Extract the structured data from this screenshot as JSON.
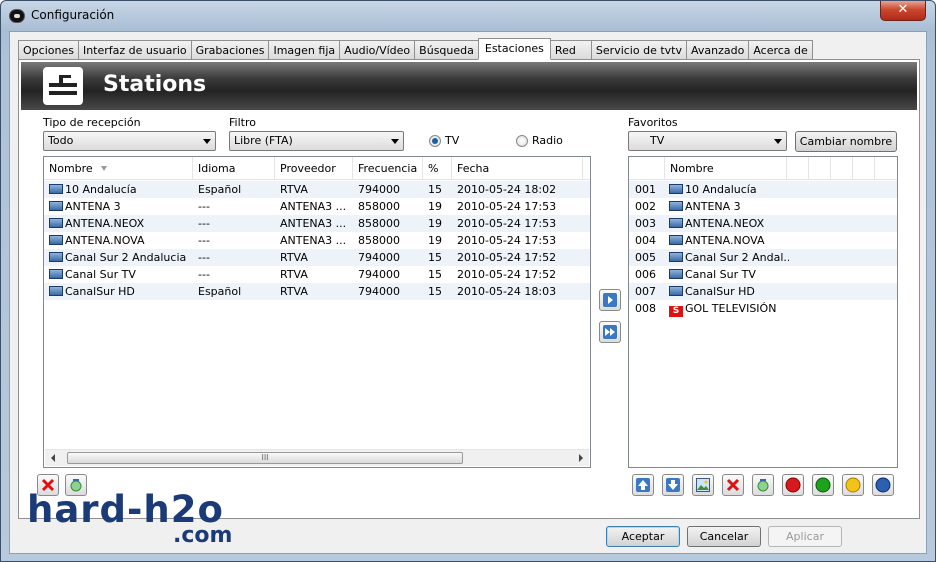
{
  "window": {
    "title": "Configuración",
    "close_glyph": "✕"
  },
  "tabs": [
    {
      "label": "Opciones"
    },
    {
      "label": "Interfaz de usuario"
    },
    {
      "label": "Grabaciones"
    },
    {
      "label": "Imagen fija"
    },
    {
      "label": "Audio/Vídeo"
    },
    {
      "label": "Búsqueda"
    },
    {
      "label": "Estaciones"
    },
    {
      "label": "Red"
    },
    {
      "label": "Servicio de tvtv"
    },
    {
      "label": "Avanzado"
    },
    {
      "label": "Acerca de"
    }
  ],
  "active_tab": "Estaciones",
  "banner": {
    "title": "Stations",
    "icon": "stations-icon"
  },
  "reception": {
    "label": "Tipo de recepción",
    "value": "Todo"
  },
  "filter": {
    "label": "Filtro",
    "value": "Libre (FTA)"
  },
  "mode": {
    "tv_label": "TV",
    "radio_label": "Radio",
    "selected": "TV"
  },
  "favorites": {
    "label": "Favoritos",
    "value": "TV",
    "rename_button": "Cambiar nombre"
  },
  "stations_table": {
    "columns": [
      "Nombre",
      "Idioma",
      "Proveedor",
      "Frecuencia",
      "%",
      "Fecha"
    ],
    "rows": [
      [
        "10 Andalucía",
        "Español",
        "RTVA",
        "794000",
        "15",
        "2010-05-24 18:02"
      ],
      [
        "ANTENA 3",
        "---",
        "ANTENA3 ...",
        "858000",
        "19",
        "2010-05-24 17:53"
      ],
      [
        "ANTENA.NEOX",
        "---",
        "ANTENA3 ...",
        "858000",
        "19",
        "2010-05-24 17:53"
      ],
      [
        "ANTENA.NOVA",
        "---",
        "ANTENA3 ...",
        "858000",
        "19",
        "2010-05-24 17:53"
      ],
      [
        "Canal Sur 2 Andalucia",
        "---",
        "RTVA",
        "794000",
        "15",
        "2010-05-24 17:52"
      ],
      [
        "Canal Sur TV",
        "---",
        "RTVA",
        "794000",
        "15",
        "2010-05-24 17:52"
      ],
      [
        "CanalSur HD",
        "Español",
        "RTVA",
        "794000",
        "15",
        "2010-05-24 18:03"
      ]
    ],
    "scroll_thumb_grip": "III"
  },
  "favorites_table": {
    "columns": [
      "Nombre"
    ],
    "rows": [
      {
        "num": "001",
        "name": "10 Andalucía",
        "icon": "tv-icon"
      },
      {
        "num": "002",
        "name": "ANTENA 3",
        "icon": "tv-icon"
      },
      {
        "num": "003",
        "name": "ANTENA.NEOX",
        "icon": "tv-icon"
      },
      {
        "num": "004",
        "name": "ANTENA.NOVA",
        "icon": "tv-icon"
      },
      {
        "num": "005",
        "name": "Canal Sur 2 Andal...",
        "icon": "tv-icon"
      },
      {
        "num": "006",
        "name": "Canal Sur TV",
        "icon": "tv-icon"
      },
      {
        "num": "007",
        "name": "CanalSur HD",
        "icon": "tv-icon"
      },
      {
        "num": "008",
        "name": "GOL TELEVISIÓN",
        "icon": "s-icon",
        "icon_text": "S"
      }
    ]
  },
  "buttons": {
    "ok": "Aceptar",
    "cancel": "Cancelar",
    "apply": "Aplicar"
  },
  "watermark": {
    "line1": "hard-h2o",
    "line2": ".com"
  },
  "colors": {
    "accent": "#1c5fa8",
    "alt_row": "#eef3fa",
    "logo": "#1a3a78",
    "red_dot": "#d8191b",
    "green_dot": "#1ea21e",
    "yellow_dot": "#f3c316",
    "blue_dot": "#2b5fb0"
  }
}
